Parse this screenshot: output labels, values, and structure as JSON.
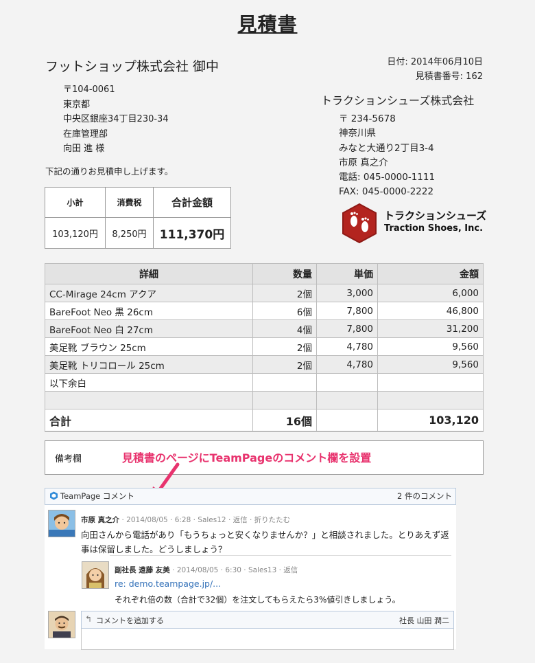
{
  "title": "見積書",
  "client": {
    "name": "フットショップ株式会社 御中",
    "address": [
      "〒104-0061",
      "東京都",
      "中央区銀座34丁目230-34",
      "在庫管理部",
      "向田 進 様"
    ]
  },
  "intro": "下記の通りお見積申し上げます。",
  "meta": {
    "date": "日付: 2014年06月10日",
    "number": "見積書番号: 162"
  },
  "company": {
    "name": "トラクションシューズ株式会社",
    "address": [
      "〒 234-5678",
      "神奈川県",
      "みなと大通り2丁目3-4",
      "市原 真之介",
      "電話: 045-0000-1111",
      "FAX: 045-0000-2222"
    ],
    "logo_text_ja": "トラクションシューズ",
    "logo_text_en": "Traction Shoes, Inc.",
    "logo_color": "#b3241f"
  },
  "summary": {
    "headers": [
      "小計",
      "消費税",
      "合計金額"
    ],
    "values": [
      "103,120円",
      "8,250円",
      "111,370円"
    ]
  },
  "items": {
    "headers": [
      "詳細",
      "数量",
      "単価",
      "金額"
    ],
    "rows": [
      [
        "CC-Mirage 24cm アクア",
        "2個",
        "3,000",
        "6,000"
      ],
      [
        "BareFoot Neo 黒 26cm",
        "6個",
        "7,800",
        "46,800"
      ],
      [
        "BareFoot Neo 白 27cm",
        "4個",
        "7,800",
        "31,200"
      ],
      [
        "美足靴 ブラウン 25cm",
        "2個",
        "4,780",
        "9,560"
      ],
      [
        "美足靴 トリコロール 25cm",
        "2個",
        "4,780",
        "9,560"
      ],
      [
        "以下余白",
        "",
        "",
        ""
      ],
      [
        "",
        "",
        "",
        ""
      ]
    ],
    "total": [
      "合計",
      "16個",
      "",
      "103,120"
    ]
  },
  "remarks": {
    "label": "備考欄",
    "callout": "見積書のページにTeamPageのコメント欄を設置",
    "callout_color": "#e8336e"
  },
  "teampage": {
    "title": "TeamPage コメント",
    "count": "2 件のコメント",
    "comments": [
      {
        "author": "市原 真之介",
        "meta": " · 2014/08/05 · 6:28 · Sales12 · 返信 · 折りたたむ",
        "text": "向田さんから電話があり「もうちょっと安くなりませんか？」と相談されました。とりあえず返事は保留しました。どうしましょう？"
      },
      {
        "author": "副社長 遠藤 友美",
        "meta": " · 2014/08/05 · 6:30 · Sales13 · 返信",
        "link": "re: demo.teampage.jp/...",
        "text": "それぞれ倍の数（合計で32個）を注文してもらえたら3%値引きしましょう。"
      }
    ],
    "add_comment": "コメントを追加する",
    "current_user": "社長 山田 潤二"
  }
}
